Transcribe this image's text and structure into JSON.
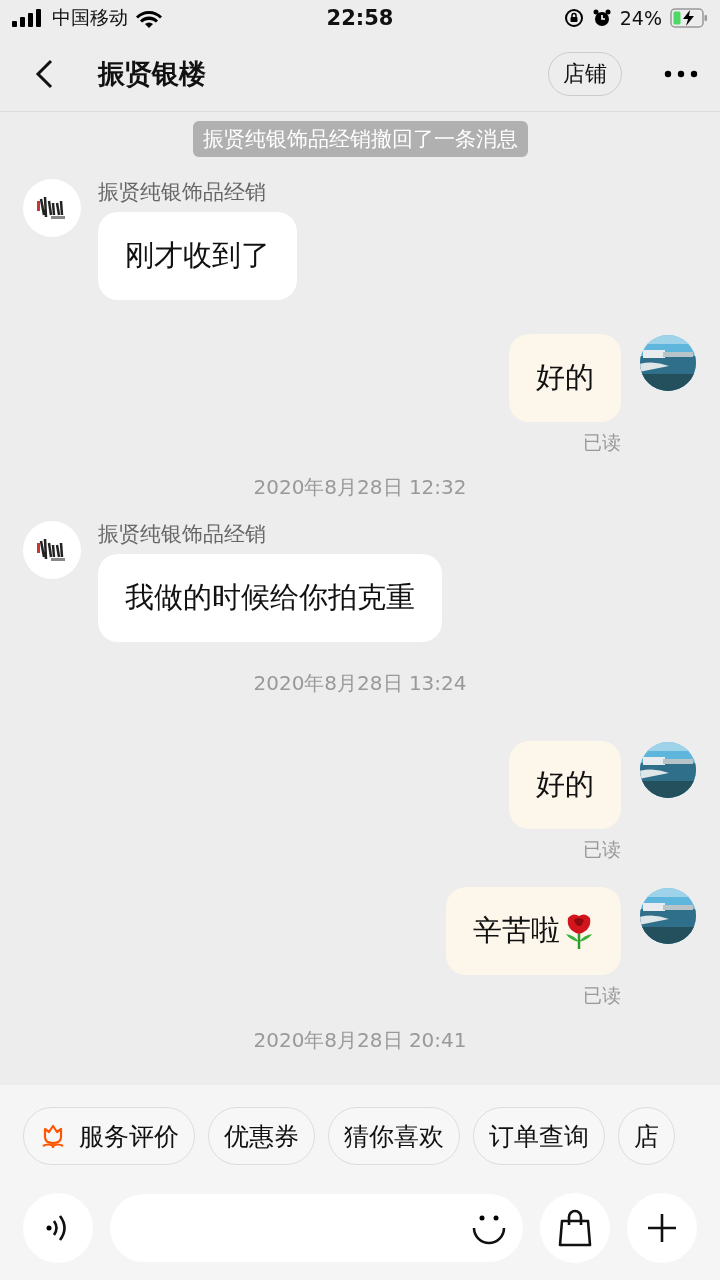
{
  "status_bar": {
    "carrier": "中国移动",
    "time": "22:58",
    "battery": "24%"
  },
  "nav": {
    "title": "振贤银楼",
    "shop_button": "店铺"
  },
  "messages": [
    {
      "kind": "notice",
      "text": "振贤纯银饰品经销撤回了一条消息"
    },
    {
      "kind": "incoming",
      "sender": "振贤纯银饰品经销",
      "text": "刚才收到了"
    },
    {
      "kind": "outgoing",
      "text": "好的",
      "status": "已读"
    },
    {
      "kind": "time",
      "text": "2020年8月28日 12:32"
    },
    {
      "kind": "incoming",
      "sender": "振贤纯银饰品经销",
      "text": "我做的时候给你拍克重"
    },
    {
      "kind": "time",
      "text": "2020年8月28日 13:24"
    },
    {
      "kind": "outgoing",
      "text": "好的",
      "status": "已读"
    },
    {
      "kind": "sticker",
      "text": "辛苦啦",
      "status": "已读"
    },
    {
      "kind": "time",
      "text": "2020年8月28日 20:41"
    }
  ],
  "quick_replies": [
    {
      "label": "服务评价",
      "kind": "icon"
    },
    {
      "label": "优惠券",
      "kind": "text"
    },
    {
      "label": "猜你喜欢",
      "kind": "text"
    },
    {
      "label": "订单查询",
      "kind": "text"
    },
    {
      "label": "店",
      "kind": "text"
    }
  ]
}
